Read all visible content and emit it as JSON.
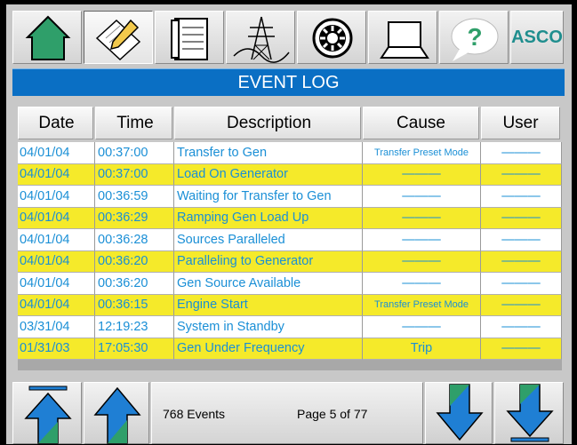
{
  "toolbar": {
    "items": [
      {
        "name": "home",
        "icon": "house-icon",
        "active": false
      },
      {
        "name": "event-log",
        "icon": "pencil-notepad-icon",
        "active": true
      },
      {
        "name": "report",
        "icon": "clipboard-icon",
        "active": false
      },
      {
        "name": "one-line",
        "icon": "power-tower-icon",
        "active": false
      },
      {
        "name": "engine",
        "icon": "gear-wheel-icon",
        "active": false
      },
      {
        "name": "computer",
        "icon": "laptop-icon",
        "active": false
      },
      {
        "name": "help",
        "icon": "help-bubble-icon",
        "active": false
      },
      {
        "name": "asco",
        "label": "ASCO",
        "active": false
      }
    ]
  },
  "header": {
    "title": "EVENT LOG"
  },
  "table": {
    "columns": [
      "Date",
      "Time",
      "Description",
      "Cause",
      "User"
    ],
    "rows": [
      {
        "date": "04/01/04",
        "time": "00:37:00",
        "description": "Transfer to Gen",
        "cause": "Transfer Preset Mode",
        "user": "———"
      },
      {
        "date": "04/01/04",
        "time": "00:37:00",
        "description": "Load On Generator",
        "cause": "———",
        "user": "———"
      },
      {
        "date": "04/01/04",
        "time": "00:36:59",
        "description": "Waiting for Transfer to Gen",
        "cause": "———",
        "user": "———"
      },
      {
        "date": "04/01/04",
        "time": "00:36:29",
        "description": "Ramping Gen Load Up",
        "cause": "———",
        "user": "———"
      },
      {
        "date": "04/01/04",
        "time": "00:36:28",
        "description": "Sources Paralleled",
        "cause": "———",
        "user": "———"
      },
      {
        "date": "04/01/04",
        "time": "00:36:20",
        "description": "Paralleling to Generator",
        "cause": "———",
        "user": "———"
      },
      {
        "date": "04/01/04",
        "time": "00:36:20",
        "description": "Gen Source Available",
        "cause": "———",
        "user": "———"
      },
      {
        "date": "04/01/04",
        "time": "00:36:15",
        "description": "Engine Start",
        "cause": "Transfer Preset Mode",
        "user": "———"
      },
      {
        "date": "03/31/04",
        "time": "12:19:23",
        "description": "System in Standby",
        "cause": "———",
        "user": "———"
      },
      {
        "date": "01/31/03",
        "time": "17:05:30",
        "description": "Gen Under Frequency",
        "cause": "Trip",
        "user": "———"
      }
    ]
  },
  "footer": {
    "events_label": "768 Events",
    "page_label": "Page 5 of 77",
    "buttons": [
      "first-page-icon",
      "previous-page-icon",
      "next-page-icon",
      "last-page-icon"
    ]
  },
  "colors": {
    "header_blue": "#0a6fc4",
    "row_yellow": "#f5ea2a",
    "text_blue": "#1a8fd6",
    "arrow_blue": "#1f7fd4",
    "icon_green": "#2f9f6a"
  }
}
